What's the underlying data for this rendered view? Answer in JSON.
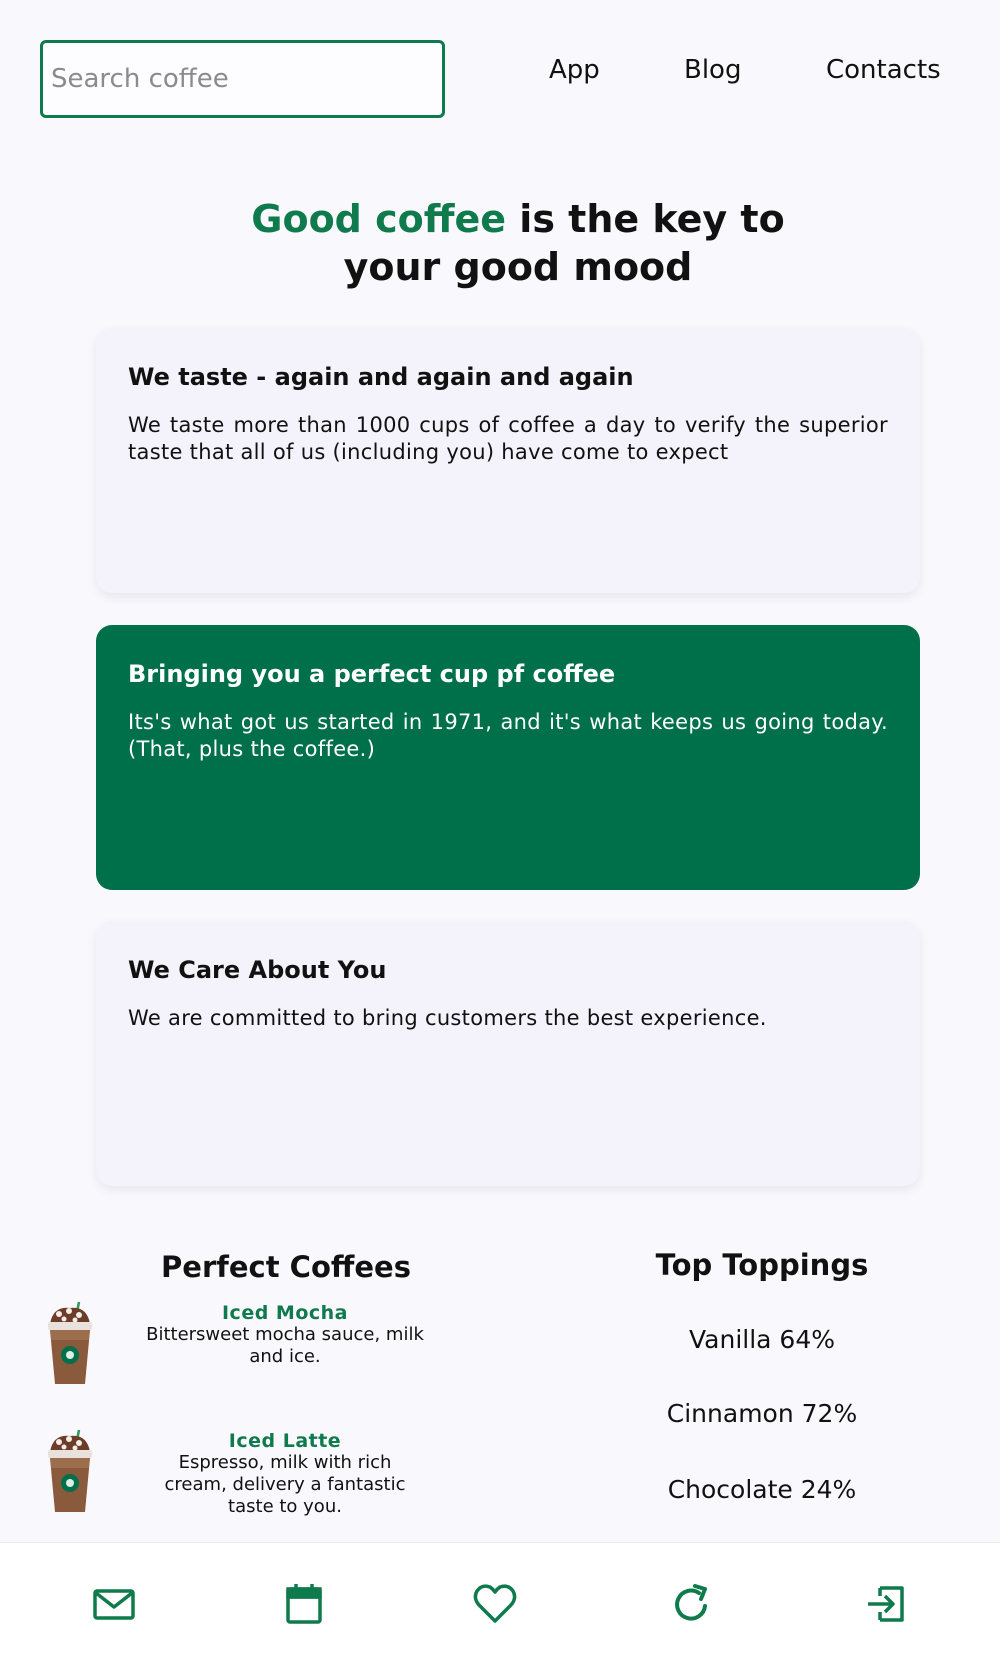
{
  "search": {
    "placeholder": "Search coffee",
    "value": ""
  },
  "nav": {
    "items": [
      "App",
      "Blog",
      "Contacts"
    ]
  },
  "hero": {
    "accent": "Good coffee",
    "rest": " is the key to",
    "line2": "your good mood"
  },
  "cards": [
    {
      "title": "We taste - again and again and again",
      "text": "We taste more than 1000 cups of coffee a day to verify the superior taste that all of us (including you) have come to expect"
    },
    {
      "title": "Bringing you a perfect cup pf coffee",
      "text": "Its's what got us started in 1971, and it's what keeps us going today. (That, plus the coffee.)"
    },
    {
      "title": "We Care About You",
      "text": "We are committed to bring customers the best experience."
    }
  ],
  "coffees": {
    "heading": "Perfect Coffees",
    "items": [
      {
        "name": "Iced Mocha",
        "description": "Bittersweet mocha sauce, milk and ice."
      },
      {
        "name": "Iced Latte",
        "description": "Espresso, milk with rich cream, delivery a fantastic taste to you."
      }
    ]
  },
  "toppings": {
    "heading": "Top Toppings",
    "items": [
      "Vanilla 64%",
      "Cinnamon 72%",
      "Chocolate 24%"
    ]
  },
  "bottom_nav": {
    "icons": [
      "mail-icon",
      "calendar-icon",
      "heart-icon",
      "refresh-icon",
      "logout-icon"
    ]
  },
  "colors": {
    "accent": "#0f7a4c",
    "featured_card": "#00704a",
    "background": "#f9f8fc",
    "card": "#f4f2fa"
  }
}
